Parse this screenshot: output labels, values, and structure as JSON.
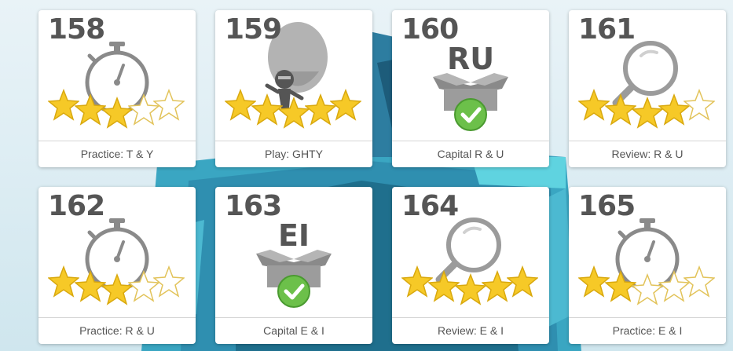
{
  "levels": [
    {
      "number": "158",
      "label": "Practice: T & Y",
      "icon": "stopwatch-icon",
      "stars": 3
    },
    {
      "number": "159",
      "label": "Play: GHTY",
      "icon": "balloon-ninja-icon",
      "stars": 5
    },
    {
      "number": "160",
      "label": "Capital R & U",
      "icon": "box-check-icon",
      "letters": "RU",
      "stars": 0
    },
    {
      "number": "161",
      "label": "Review: R & U",
      "icon": "magnifier-icon",
      "stars": 4
    },
    {
      "number": "162",
      "label": "Practice: R & U",
      "icon": "stopwatch-icon",
      "stars": 3
    },
    {
      "number": "163",
      "label": "Capital E & I",
      "icon": "box-check-icon",
      "letters": "EI",
      "stars": 0
    },
    {
      "number": "164",
      "label": "Review: E & I",
      "icon": "magnifier-icon",
      "stars": 5
    },
    {
      "number": "165",
      "label": "Practice: E & I",
      "icon": "stopwatch-icon",
      "stars": 2
    }
  ],
  "colors": {
    "star_gold": "#f6c927",
    "star_empty": "#ffffff",
    "check_green": "#6cc04a",
    "icon_gray": "#8a8a8a",
    "number_gray": "#555555"
  }
}
